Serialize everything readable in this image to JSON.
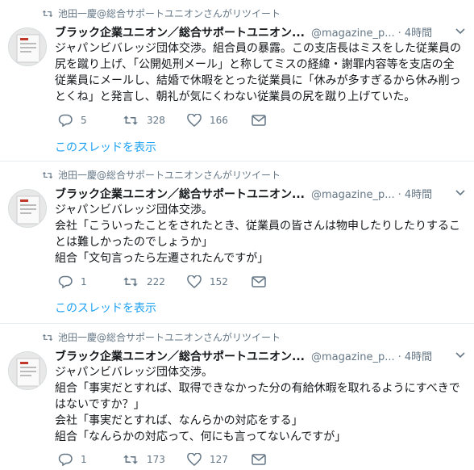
{
  "tweets": [
    {
      "retweet_text": "池田一慶@総合サポートユニオンさんがリツイート",
      "name": "ブラック企業ユニオン／総合サポートユニオン...",
      "handle": "@magazine_p...",
      "time": "· 4時間",
      "lines": [
        "ジャパンビバレッジ団体交渉。組合員の暴露。この支店長はミスをした従業員の",
        "尻を蹴り上げ、「公開処刑メール」と称してミスの経緯・謝罪内容等を支店の全",
        "従業員にメールし、結婚で休暇をとった従業員に「休みが多すぎるから休み削っ",
        "とくね」と発言し、朝礼が気にくわない従業員の尻を蹴り上げていた。"
      ],
      "replies": "5",
      "retweets": "328",
      "likes": "166",
      "thread_link": "このスレッドを表示"
    },
    {
      "retweet_text": "池田一慶@総合サポートユニオンさんがリツイート",
      "name": "ブラック企業ユニオン／総合サポートユニオン...",
      "handle": "@magazine_p...",
      "time": "· 4時間",
      "lines": [
        "ジャパンビバレッジ団体交渉。",
        "会社「こういったことをされたとき、従業員の皆さんは物申したりしたりするこ",
        "とは難しかったのでしょうか」",
        "組合「文句言ったら左遷されたんですが」"
      ],
      "replies": "1",
      "retweets": "222",
      "likes": "152",
      "thread_link": "このスレッドを表示"
    },
    {
      "retweet_text": "池田一慶@総合サポートユニオンさんがリツイート",
      "name": "ブラック企業ユニオン／総合サポートユニオン...",
      "handle": "@magazine_p...",
      "time": "· 4時間",
      "lines": [
        "ジャパンビバレッジ団体交渉。",
        "組合「事実だとすれば、取得できなかった分の有給休暇を取れるようにすべきで",
        "はないですか？」",
        "会社「事実だとすれば、なんらかの対応をする」",
        "組合「なんらかの対応って、何にも言ってないんですが」"
      ],
      "replies": "1",
      "retweets": "173",
      "likes": "127"
    }
  ],
  "colors": {
    "text": "#14171a",
    "muted": "#657786",
    "link": "#1da1f2",
    "border": "#e6ecf0"
  }
}
